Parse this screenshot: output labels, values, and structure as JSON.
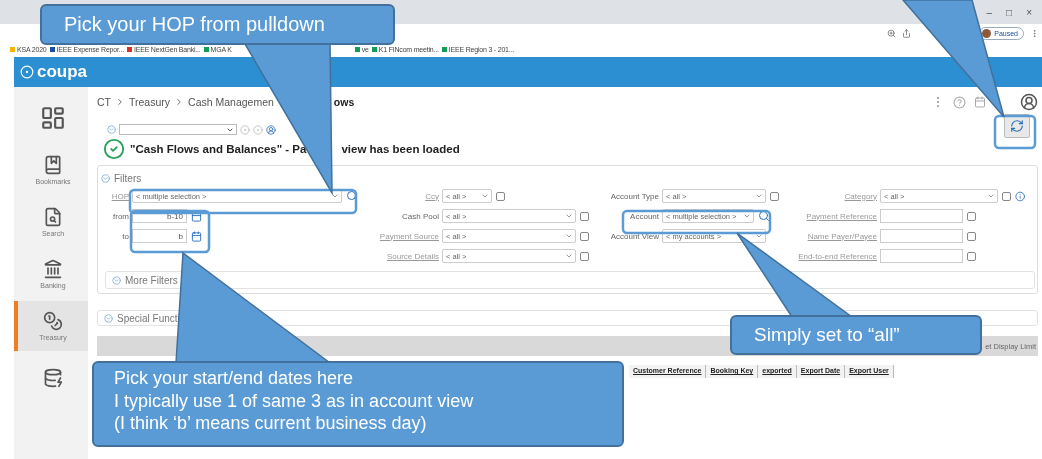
{
  "browser": {
    "window_controls": [
      "–",
      "□",
      "×"
    ],
    "profile": "Paused",
    "bookmarks": [
      {
        "label": "KSA 2020",
        "color": "#f4b400"
      },
      {
        "label": "IEEE Expense Repor...",
        "color": "#1a4fa0"
      },
      {
        "label": "IEEE NextGen Banki...",
        "color": "#d93025"
      },
      {
        "label": "MGA K",
        "color": "#0f9d58"
      },
      {
        "label": "ve",
        "color": "#0f9d58"
      },
      {
        "label": "K1 FINcom meetin...",
        "color": "#0f9d58"
      },
      {
        "label": "IEEE Region 3 - 201...",
        "color": "#0f9d58"
      }
    ]
  },
  "app": {
    "logo": "coupa"
  },
  "sidebar": {
    "items": [
      {
        "kind": "dashboard",
        "selected": false
      },
      {
        "kind": "bookmarks",
        "label": "Bookmarks",
        "selected": false
      },
      {
        "kind": "search",
        "label": "Search",
        "selected": false
      },
      {
        "kind": "banking",
        "label": "Banking",
        "selected": false
      },
      {
        "kind": "treasury",
        "label": "Treasury",
        "selected": true
      },
      {
        "kind": "data",
        "selected": false
      }
    ]
  },
  "breadcrumb": [
    "CT",
    "Treasury",
    "Cash Managemen",
    "ows"
  ],
  "message": [
    "\"Cash Flows and Balances\" - Pa",
    "view has been loaded"
  ],
  "filters": {
    "title": "Filters",
    "rows": [
      [
        {
          "label": "HOP",
          "link": true,
          "kind": "select",
          "value": "< multiple selection >",
          "search": true
        },
        {
          "label": "Ccy",
          "link": true,
          "kind": "select",
          "value": "< all >",
          "checkbox": false,
          "narrow": true
        },
        {
          "label": "Account Type",
          "link": false,
          "kind": "select",
          "value": "< all >",
          "checkbox": false
        },
        {
          "label": "Category",
          "link": true,
          "kind": "select",
          "value": "< all >",
          "checkbox": false,
          "info": true
        }
      ],
      [
        {
          "label": "from",
          "link": false,
          "kind": "date",
          "value": "b-10"
        },
        {
          "label": "Cash Pool",
          "link": false,
          "kind": "select",
          "value": "< all >",
          "checkbox": false
        },
        {
          "label": "Account",
          "link": false,
          "kind": "select",
          "value": "< multiple selection >",
          "search": true
        },
        {
          "label": "Payment Reference",
          "link": true,
          "kind": "text",
          "checkbox": false
        }
      ],
      [
        {
          "label": "to",
          "link": false,
          "kind": "date",
          "value": "b"
        },
        {
          "label": "Payment Source",
          "link": true,
          "kind": "select",
          "value": "< all >",
          "checkbox": false
        },
        {
          "label": "Account View",
          "link": false,
          "kind": "select",
          "value": "< my accounts >"
        },
        {
          "label": "Name Payer/Payee",
          "link": true,
          "kind": "text",
          "checkbox": false
        }
      ],
      [
        null,
        {
          "label": "Source Details",
          "link": true,
          "kind": "select",
          "value": "< all >",
          "checkbox": false
        },
        null,
        {
          "label": "End-to-end Reference",
          "link": true,
          "kind": "text",
          "checkbox": false
        }
      ]
    ],
    "more": "More Filters"
  },
  "special": "Special Functi",
  "results": {
    "limit": "et Display Limit",
    "columns": [
      "Customer Reference",
      "Booking Key",
      "exported",
      "Export Date",
      "Export User"
    ]
  },
  "callouts": [
    {
      "kind": "hop",
      "lines": [
        "Pick your HOP from pulldown"
      ]
    },
    {
      "kind": "refresh"
    },
    {
      "kind": "account",
      "lines": [
        "Simply set to “all”"
      ]
    },
    {
      "kind": "dates",
      "lines": [
        "Pick your start/end dates here",
        "I typically use 1 of same 3 as in account view",
        "(I think ‘b’ means current business day)"
      ]
    }
  ]
}
